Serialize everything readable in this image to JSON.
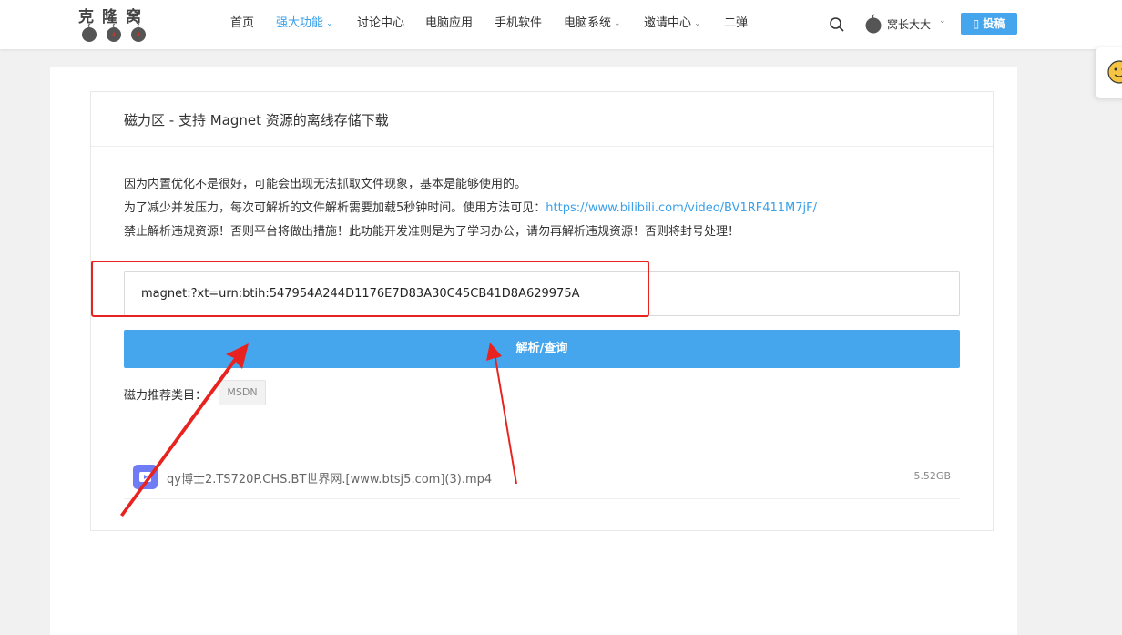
{
  "logo": {
    "text": "克隆窝"
  },
  "nav": {
    "items": [
      {
        "label": "首页",
        "has_dropdown": false,
        "active": false
      },
      {
        "label": "强大功能",
        "has_dropdown": true,
        "active": true
      },
      {
        "label": "讨论中心",
        "has_dropdown": false,
        "active": false
      },
      {
        "label": "电脑应用",
        "has_dropdown": false,
        "active": false
      },
      {
        "label": "手机软件",
        "has_dropdown": false,
        "active": false
      },
      {
        "label": "电脑系统",
        "has_dropdown": true,
        "active": false
      },
      {
        "label": "邀请中心",
        "has_dropdown": true,
        "active": false
      },
      {
        "label": "二弹",
        "has_dropdown": false,
        "active": false
      }
    ]
  },
  "user": {
    "name": "窝长大大"
  },
  "post_button": {
    "label": "投稿"
  },
  "card": {
    "title": "磁力区 - 支持 Magnet 资源的离线存储下载",
    "notice_line1": "因为内置优化不是很好，可能会出现无法抓取文件现象，基本是能够使用的。",
    "notice_line2_prefix": "为了减少并发压力，每次可解析的文件解析需要加载5秒钟时间。使用方法可见：",
    "notice_line2_link": "https://www.bilibili.com/video/BV1RF411M7jF/",
    "notice_line3": "禁止解析违规资源！否则平台将做出措施！此功能开发准则是为了学习办公，请勿再解析违规资源！否则将封号处理！",
    "magnet_value": "magnet:?xt=urn:btih:547954A244D1176E7D83A30C45CB41D8A629975A",
    "parse_button": "解析/查询",
    "category_label": "磁力推荐类目：",
    "category_tag": "MSDN",
    "files": [
      {
        "name": "qy博士2.TS720P.CHS.BT世界网.[www.btsj5.com](3).mp4",
        "size": "5.52GB"
      }
    ]
  },
  "colors": {
    "accent": "#45a6ee",
    "link": "#3aa0e8",
    "annotation_red": "#e8231f",
    "file_icon": "#6f7cf5"
  }
}
